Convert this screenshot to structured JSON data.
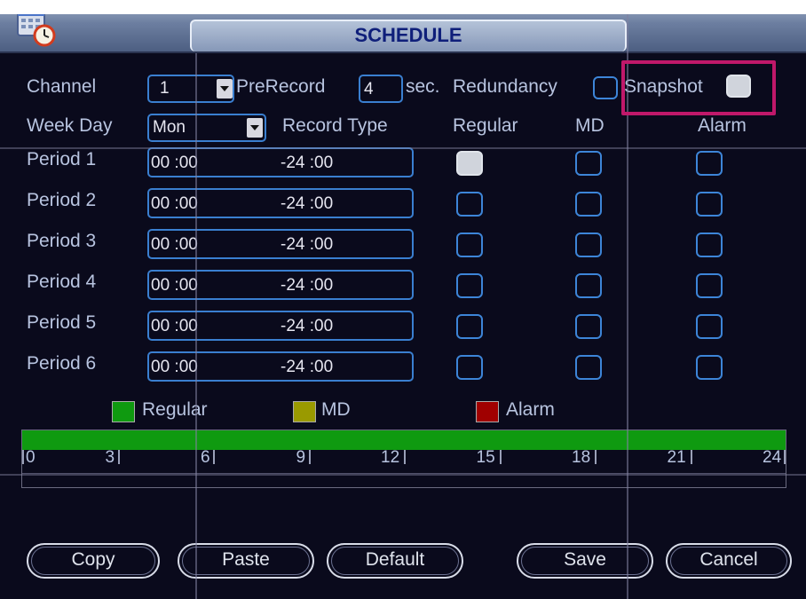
{
  "window": {
    "title": "SCHEDULE"
  },
  "header_row": {
    "channel_label": "Channel",
    "channel_value": "1",
    "prerecord_label": "PreRecord",
    "prerecord_value": "4",
    "sec_label": "sec.",
    "redundancy_label": "Redundancy",
    "redundancy_checked": false,
    "snapshot_label": "Snapshot",
    "snapshot_checked": true
  },
  "weekday_row": {
    "weekday_label": "Week Day",
    "weekday_value": "Mon",
    "record_type_label": "Record Type",
    "col_regular": "Regular",
    "col_md": "MD",
    "col_alarm": "Alarm"
  },
  "periods": [
    {
      "label": "Period 1",
      "start": "00 :00",
      "end": "-24 :00",
      "regular": true,
      "md": false,
      "alarm": false
    },
    {
      "label": "Period 2",
      "start": "00 :00",
      "end": "-24 :00",
      "regular": false,
      "md": false,
      "alarm": false
    },
    {
      "label": "Period 3",
      "start": "00 :00",
      "end": "-24 :00",
      "regular": false,
      "md": false,
      "alarm": false
    },
    {
      "label": "Period 4",
      "start": "00 :00",
      "end": "-24 :00",
      "regular": false,
      "md": false,
      "alarm": false
    },
    {
      "label": "Period 5",
      "start": "00 :00",
      "end": "-24 :00",
      "regular": false,
      "md": false,
      "alarm": false
    },
    {
      "label": "Period 6",
      "start": "00 :00",
      "end": "-24 :00",
      "regular": false,
      "md": false,
      "alarm": false
    }
  ],
  "legend": {
    "regular_label": "Regular",
    "md_label": "MD",
    "alarm_label": "Alarm",
    "regular_color": "#0f9a10",
    "md_color": "#9a9a00",
    "alarm_color": "#a00000"
  },
  "timeline": {
    "bar_color": "#0f9a10",
    "coverage": [
      0,
      24
    ],
    "ticks": [
      "0",
      "3",
      "6",
      "9",
      "12",
      "15",
      "18",
      "21",
      "24"
    ]
  },
  "buttons": {
    "copy": "Copy",
    "paste": "Paste",
    "default": "Default",
    "save": "Save",
    "cancel": "Cancel"
  },
  "icons": {
    "app_icon": "calendar-clock-icon"
  }
}
